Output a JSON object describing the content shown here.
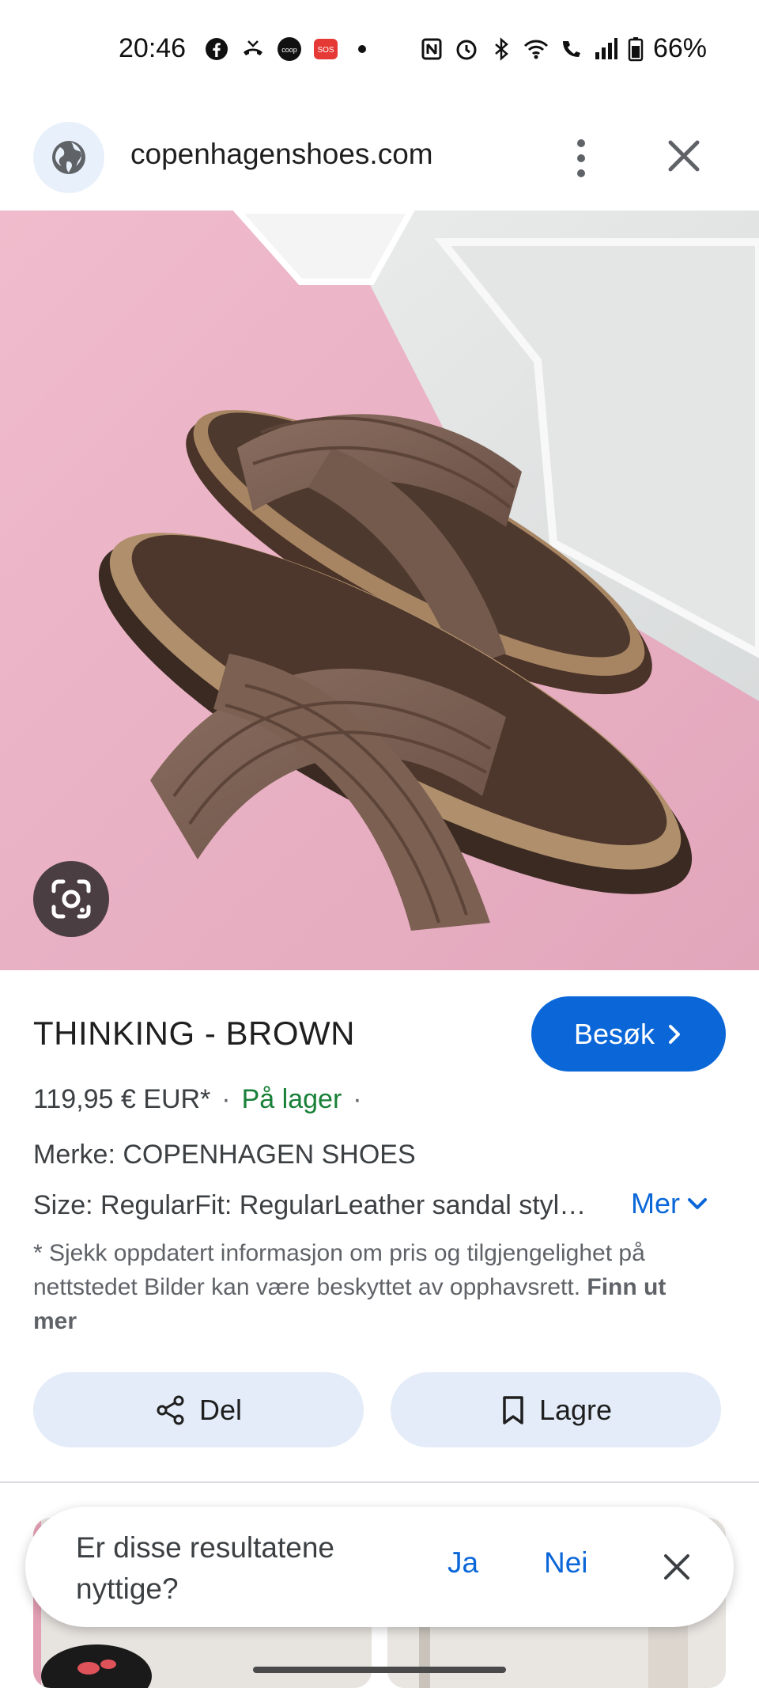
{
  "status_bar": {
    "time": "20:46",
    "battery": "66%",
    "left_icons": [
      "facebook-icon",
      "missed-call-icon",
      "coop-icon",
      "sos-icon",
      "dot-icon"
    ],
    "right_icons": [
      "nfc-icon",
      "alarm-icon",
      "bluetooth-icon",
      "wifi-icon",
      "wifi-call-icon",
      "signal-icon",
      "battery-icon"
    ]
  },
  "browser": {
    "url": "copenhagenshoes.com"
  },
  "product": {
    "title": "THINKING - BROWN",
    "visit_label": "Besøk",
    "price": "119,95 € EUR*",
    "sep1": "·",
    "stock": "På lager",
    "sep2": "·",
    "brand": "Merke: COPENHAGEN SHOES",
    "size_line": "Size: RegularFit: RegularLeather sandal styl…",
    "more_label": "Mer",
    "disclaimer": "* Sjekk oppdatert informasjon om pris og tilgjengelighet på nettstedet Bilder kan være beskyttet av opphavsrett.",
    "find_out_more": "Finn ut mer"
  },
  "actions": {
    "share_label": "Del",
    "save_label": "Lagre"
  },
  "feedback": {
    "question": "Er disse resultatene nyttige?",
    "yes": "Ja",
    "no": "Nei"
  },
  "colors": {
    "accent": "#0b67d8",
    "stock_green": "#188038",
    "button_bg": "#e3ecf8",
    "hero_pink": "#e8b4c6"
  }
}
